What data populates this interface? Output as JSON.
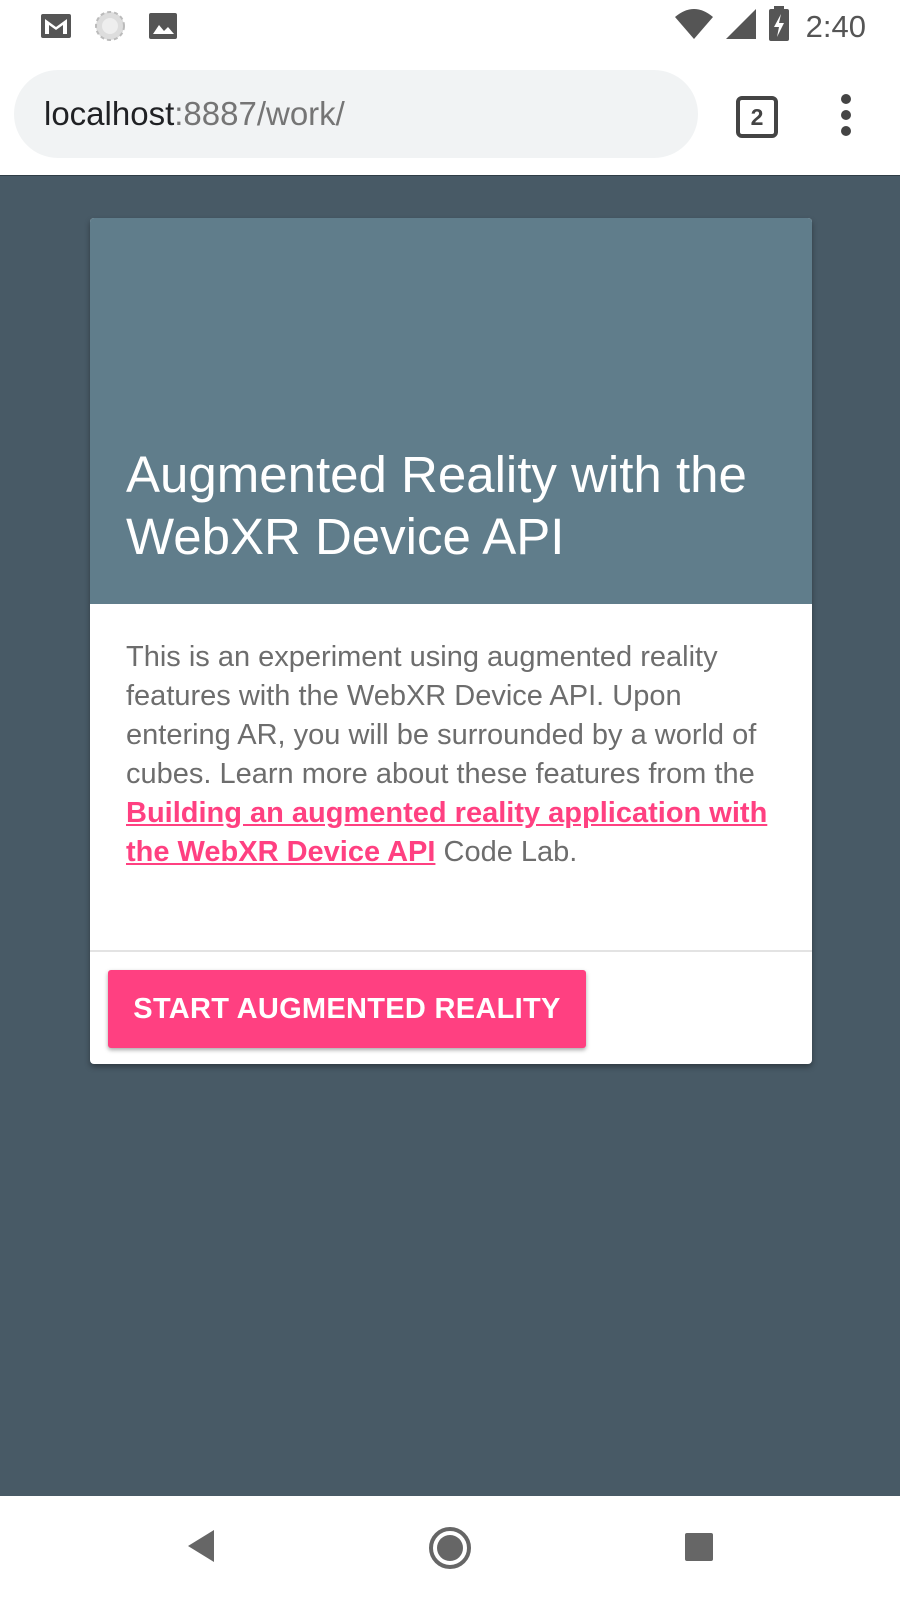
{
  "status_bar": {
    "time": "2:40",
    "icons": [
      "gmail-icon",
      "sync-icon",
      "image-icon",
      "wifi-icon",
      "signal-icon",
      "battery-charging-icon"
    ]
  },
  "browser": {
    "url_host": "localhost",
    "url_path": ":8887/work/",
    "tab_count": "2",
    "menu_icon": "more-vert-icon"
  },
  "card": {
    "title": "Augmented Reality with the WebXR Device API",
    "body_prefix": "This is an experiment using augmented reality features with the WebXR Device API. Upon entering AR, you will be surrounded by a world of cubes. Learn more about these features from the ",
    "link_text": "Building an augmented reality application with the WebXR Device API",
    "body_suffix": " Code Lab.",
    "button_label": "START AUGMENTED REALITY"
  },
  "colors": {
    "page_background": "#485a66",
    "card_header": "#607d8b",
    "accent": "#ff4081"
  },
  "nav_bar": {
    "icons": [
      "back-icon",
      "home-icon",
      "recents-icon"
    ]
  }
}
